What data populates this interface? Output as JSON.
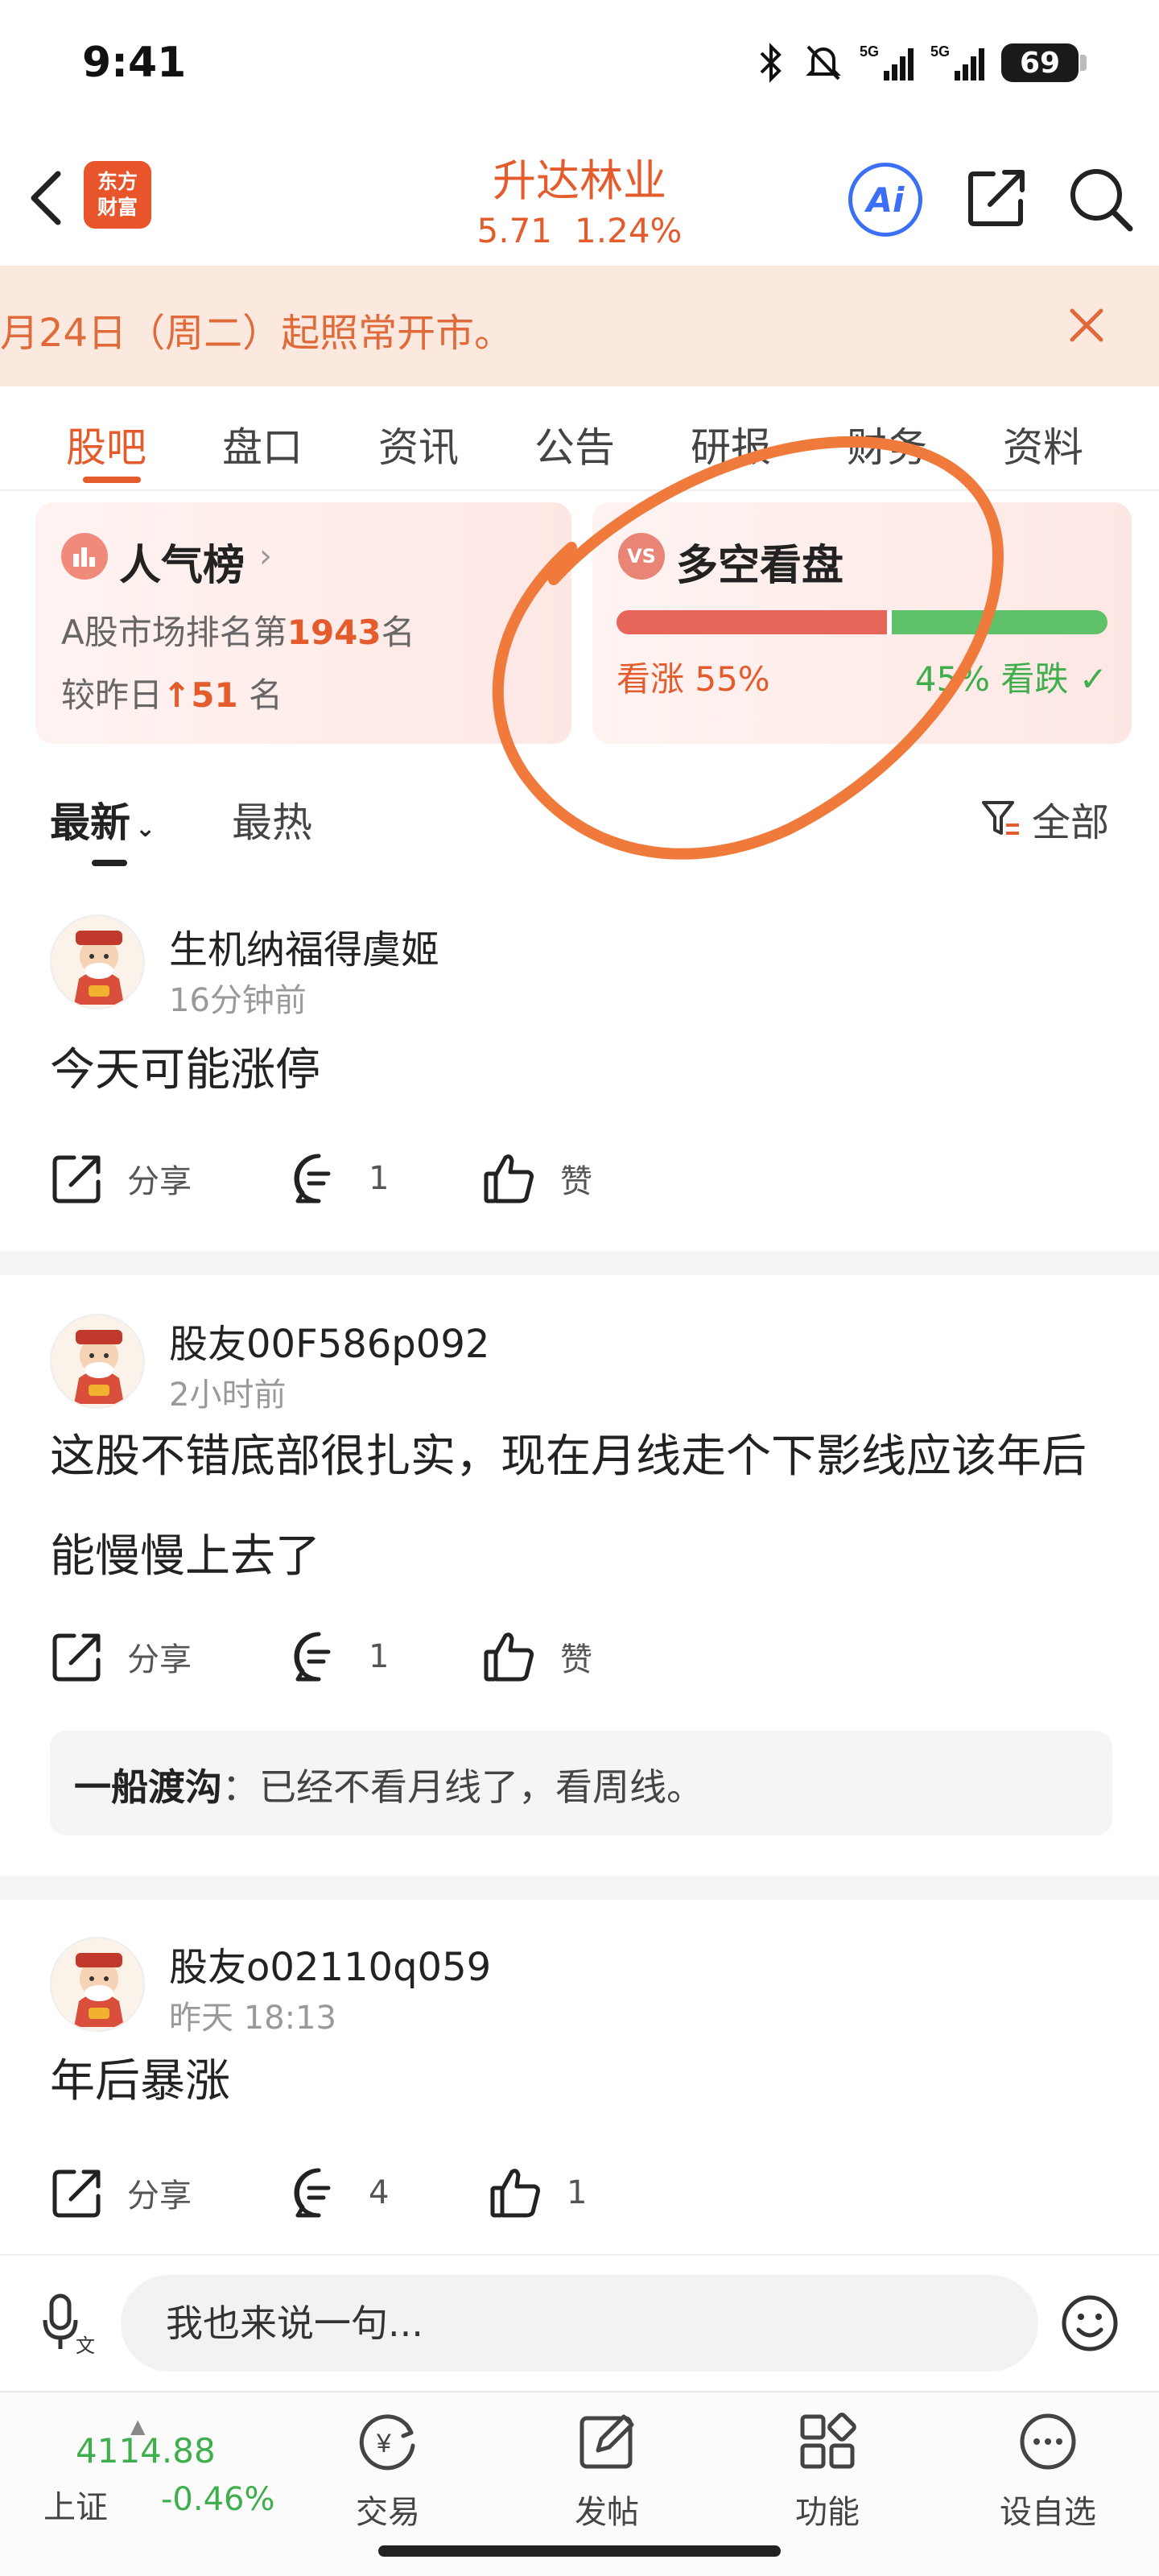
{
  "status_bar": {
    "time": "9:41",
    "battery": "69",
    "network_1": "5G",
    "network_2": "5G"
  },
  "header": {
    "brand_logo_text": "东方\n财富",
    "stock_name": "升达林业",
    "price": "5.71",
    "change_pct": "1.24%",
    "ai_label": "Ai"
  },
  "notice": {
    "text": "月24日（周二）起照常开市。"
  },
  "tabs": [
    {
      "label": "股吧",
      "active": true
    },
    {
      "label": "盘口"
    },
    {
      "label": "资讯"
    },
    {
      "label": "公告"
    },
    {
      "label": "研报"
    },
    {
      "label": "财务"
    },
    {
      "label": "资料"
    }
  ],
  "popularity_card": {
    "title": "人气榜",
    "rank_prefix": "A股市场排名第",
    "rank_value": "1943",
    "rank_suffix": "名",
    "change_prefix": "较昨日",
    "change_value": "51",
    "change_suffix": "名"
  },
  "sentiment_card": {
    "title": "多空看盘",
    "icon_text": "VS",
    "bullish_pct": 55,
    "bullish_label": "看涨 55%",
    "bearish_label": "45% 看跌"
  },
  "sort": {
    "latest": "最新",
    "hot": "最热",
    "filter": "全部"
  },
  "posts": [
    {
      "user": "生机纳福得虞姬",
      "time": "16分钟前",
      "body": "今天可能涨停",
      "share_label": "分享",
      "comment_count": "1",
      "like_label": "赞"
    },
    {
      "user": "股友00F586p092",
      "time": "2小时前",
      "body": "这股不错底部很扎实，现在月线走个下影线应该年后能慢慢上去了",
      "share_label": "分享",
      "comment_count": "1",
      "like_label": "赞",
      "reply_user": "一船渡沟",
      "reply_text": "：已经不看月线了，看周线。"
    },
    {
      "user": "股友o02110q059",
      "time": "昨天 18:13",
      "body": "年后暴涨",
      "share_label": "分享",
      "comment_count": "4",
      "like_label": "1"
    }
  ],
  "comment_bar": {
    "placeholder": "我也来说一句..."
  },
  "bottom_nav": {
    "index_value": "4114.88",
    "index_name": "上证",
    "index_change": "-0.46%",
    "items": [
      {
        "label": "交易"
      },
      {
        "label": "发帖"
      },
      {
        "label": "功能"
      },
      {
        "label": "设自选"
      }
    ]
  },
  "colors": {
    "accent": "#e45b2c",
    "up": "#e8655a",
    "down": "#5fc16a",
    "annotation": "#f07a3c"
  }
}
